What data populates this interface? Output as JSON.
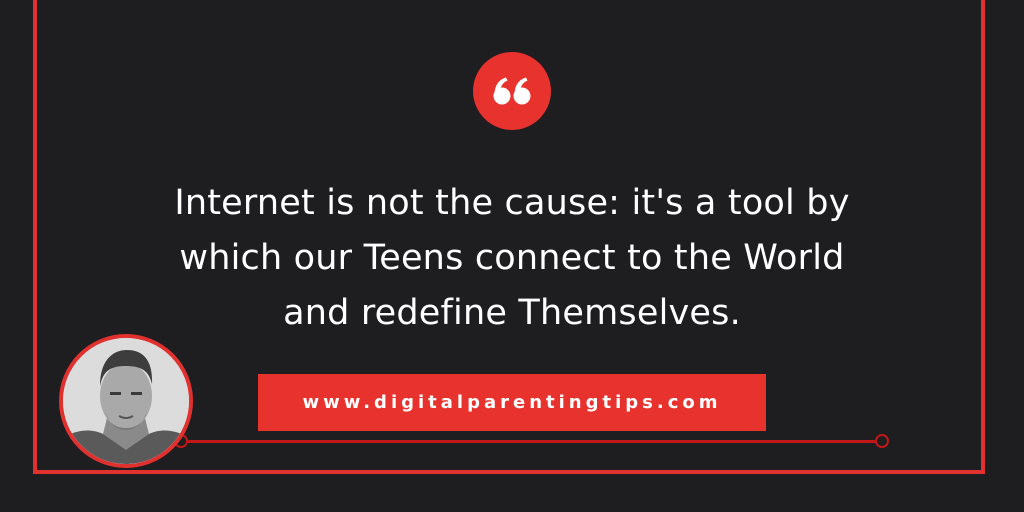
{
  "quote": {
    "icon": "quotation-mark-icon",
    "lines": [
      "Internet is not the cause: it's a tool by",
      "which our Teens connect to the World",
      "and redefine Themselves."
    ]
  },
  "website": {
    "url": "www.digitalparentingtips.com"
  },
  "colors": {
    "background": "#1e1d20",
    "accent": "#e8322e",
    "line": "#c01817",
    "text": "#ffffff"
  }
}
